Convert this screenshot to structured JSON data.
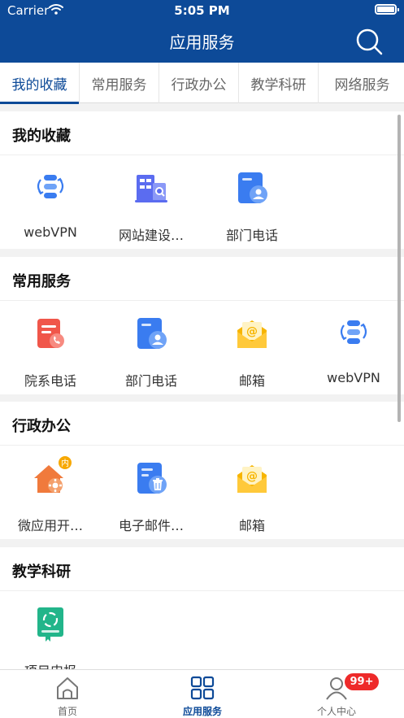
{
  "status_bar": {
    "carrier": "Carrier",
    "time": "5:05 PM"
  },
  "header": {
    "title": "应用服务",
    "search_icon": "search-icon"
  },
  "tabs": [
    {
      "label": "我的收藏",
      "active": true
    },
    {
      "label": "常用服务",
      "active": false
    },
    {
      "label": "行政办公",
      "active": false
    },
    {
      "label": "教学科研",
      "active": false
    },
    {
      "label": "网络服务",
      "active": false
    }
  ],
  "sections": [
    {
      "title": "我的收藏",
      "items": [
        {
          "label": "webVPN",
          "icon": "vpn-icon"
        },
        {
          "label": "网站建设…",
          "icon": "website-building-icon"
        },
        {
          "label": "部门电话",
          "icon": "contact-card-icon"
        }
      ]
    },
    {
      "title": "常用服务",
      "items": [
        {
          "label": "院系电话",
          "icon": "document-phone-icon"
        },
        {
          "label": "部门电话",
          "icon": "contact-card-icon"
        },
        {
          "label": "邮箱",
          "icon": "mail-icon"
        },
        {
          "label": "webVPN",
          "icon": "vpn-icon"
        }
      ]
    },
    {
      "title": "行政办公",
      "items": [
        {
          "label": "微应用开…",
          "icon": "house-gear-icon",
          "badge": "内"
        },
        {
          "label": "电子邮件…",
          "icon": "mail-trash-icon"
        },
        {
          "label": "邮箱",
          "icon": "mail-icon"
        }
      ]
    },
    {
      "title": "教学科研",
      "items": [
        {
          "label": "项目申报",
          "icon": "project-book-icon"
        }
      ]
    }
  ],
  "tabbar": {
    "items": [
      {
        "label": "首页",
        "icon": "home-icon"
      },
      {
        "label": "应用服务",
        "icon": "apps-grid-icon",
        "active": true
      },
      {
        "label": "个人中心",
        "icon": "user-icon"
      }
    ],
    "badge": "99+"
  },
  "colors": {
    "brand": "#0d4a98",
    "badge": "#ee2a2a",
    "icon_blue": "#3a7cf0",
    "icon_orange": "#f07a3c",
    "icon_yellow": "#f7b500",
    "icon_green": "#22b58a"
  }
}
